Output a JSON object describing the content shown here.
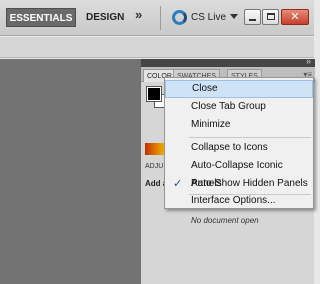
{
  "appbar": {
    "workspaces": {
      "active": "ESSENTIALS",
      "other": "DESIGN",
      "more": "»"
    },
    "cslive": {
      "label": "CS Live",
      "icon": "cs-live-icon"
    },
    "window_controls": {
      "minimize": "minimize-icon",
      "maximize": "maximize-icon",
      "close": "✕"
    }
  },
  "panel": {
    "tabs": [
      "COLOR",
      "SWATCHES",
      "STYLES"
    ],
    "menu_icon": "▾≡",
    "second_panel_tab": "ADJU",
    "second_panel_text": "Add a",
    "no_document": "No document open",
    "collapse_glyph": "»"
  },
  "context_menu": {
    "items": [
      {
        "label": "Close",
        "highlighted": true,
        "checked": false
      },
      {
        "label": "Close Tab Group",
        "highlighted": false,
        "checked": false
      },
      {
        "label": "Minimize",
        "highlighted": false,
        "checked": false
      },
      {
        "label": "Collapse to Icons",
        "highlighted": false,
        "checked": false
      },
      {
        "label": "Auto-Collapse Iconic Panels",
        "highlighted": false,
        "checked": false
      },
      {
        "label": "Auto-Show Hidden Panels",
        "highlighted": false,
        "checked": true
      },
      {
        "label": "Interface Options...",
        "highlighted": false,
        "checked": false
      }
    ],
    "check_glyph": "✓"
  },
  "colors": {
    "highlight": "#cfe3f7",
    "workspace": "#737373",
    "active_workspace_button": "#6a6a6a",
    "close_button": "#c5412c"
  }
}
